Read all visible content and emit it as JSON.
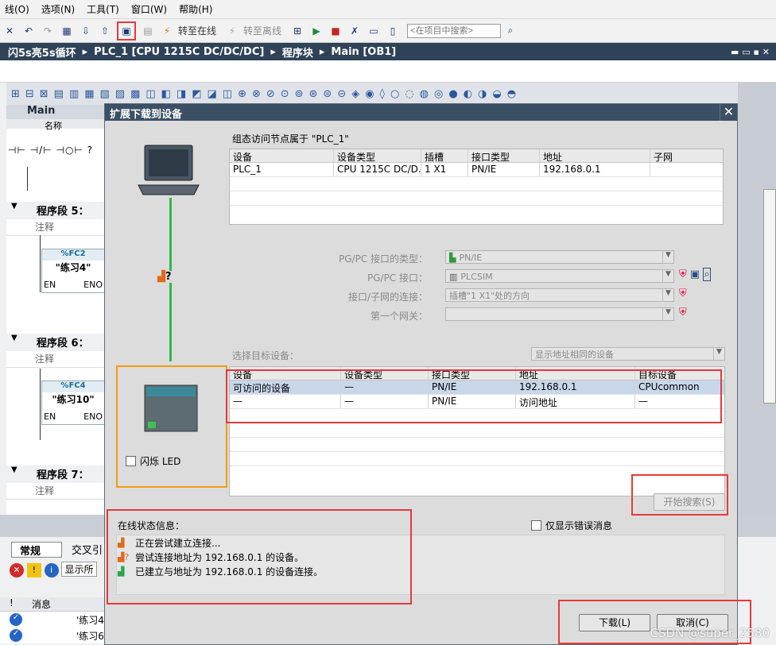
{
  "menu": [
    "线(O)",
    "选项(N)",
    "工具(T)",
    "窗口(W)",
    "帮助(H)"
  ],
  "toolbar": {
    "go_online": "转至在线",
    "go_offline": "转至离线",
    "search_placeholder": "<在项目中搜索>"
  },
  "breadcrumb": [
    "闪5s亮5s循环",
    "PLC_1 [CPU 1215C DC/DC/DC]",
    "程序块",
    "Main [OB1]"
  ],
  "editor": {
    "tab": "Main",
    "col_name": "名称",
    "segments": [
      {
        "title": "程序段 5：",
        "note": "注释",
        "fc_name": "%FC2",
        "fc_title": "\"练习4\"",
        "en": "EN",
        "eno": "ENO"
      },
      {
        "title": "程序段 6：",
        "note": "注释",
        "fc_name": "%FC4",
        "fc_title": "\"练习10\"",
        "en": "EN",
        "eno": "ENO"
      },
      {
        "title": "程序段 7：",
        "note": "注释"
      }
    ]
  },
  "bottom_pane": {
    "tab_general": "常规",
    "tab_cross": "交叉引",
    "show_all": "显示所",
    "msg_header": "消息",
    "messages": [
      "'练习4",
      "'练习6"
    ]
  },
  "dialog": {
    "title": "扩展下载到设备",
    "config_label": "组态访问节点属于 \"PLC_1\"",
    "config_headers": [
      "设备",
      "设备类型",
      "插槽",
      "接口类型",
      "地址",
      "子网"
    ],
    "config_rows": [
      [
        "PLC_1",
        "CPU 1215C DC/D...",
        "1 X1",
        "PN/IE",
        "192.168.0.1",
        ""
      ]
    ],
    "pgpc_type_label": "PG/PC 接口的类型：",
    "pgpc_type_value": "PN/IE",
    "pgpc_if_label": "PG/PC 接口：",
    "pgpc_if_value": "PLCSIM",
    "conn_label": "接口/子网的连接：",
    "conn_value": "插槽\"1 X1\"处的方向",
    "gateway_label": "第一个网关：",
    "target_label": "选择目标设备：",
    "target_filter": "显示地址相同的设备",
    "target_headers": [
      "设备",
      "设备类型",
      "接口类型",
      "地址",
      "目标设备"
    ],
    "target_rows": [
      [
        "可访问的设备",
        "—",
        "PN/IE",
        "192.168.0.1",
        "CPUcommon"
      ],
      [
        "—",
        "—",
        "PN/IE",
        "访问地址",
        "—"
      ]
    ],
    "flash_led": "闪烁 LED",
    "start_search": "开始搜索(S)",
    "status_label": "在线状态信息：",
    "only_errors": "仅显示错误消息",
    "status_messages": [
      "正在尝试建立连接...",
      "尝试连接地址为 192.168.0.1 的设备。",
      "已建立与地址为 192.168.0.1 的设备连接。"
    ],
    "download_btn": "下载(L)",
    "cancel_btn": "取消(C)"
  },
  "watermark": "CSDN @super_2580"
}
